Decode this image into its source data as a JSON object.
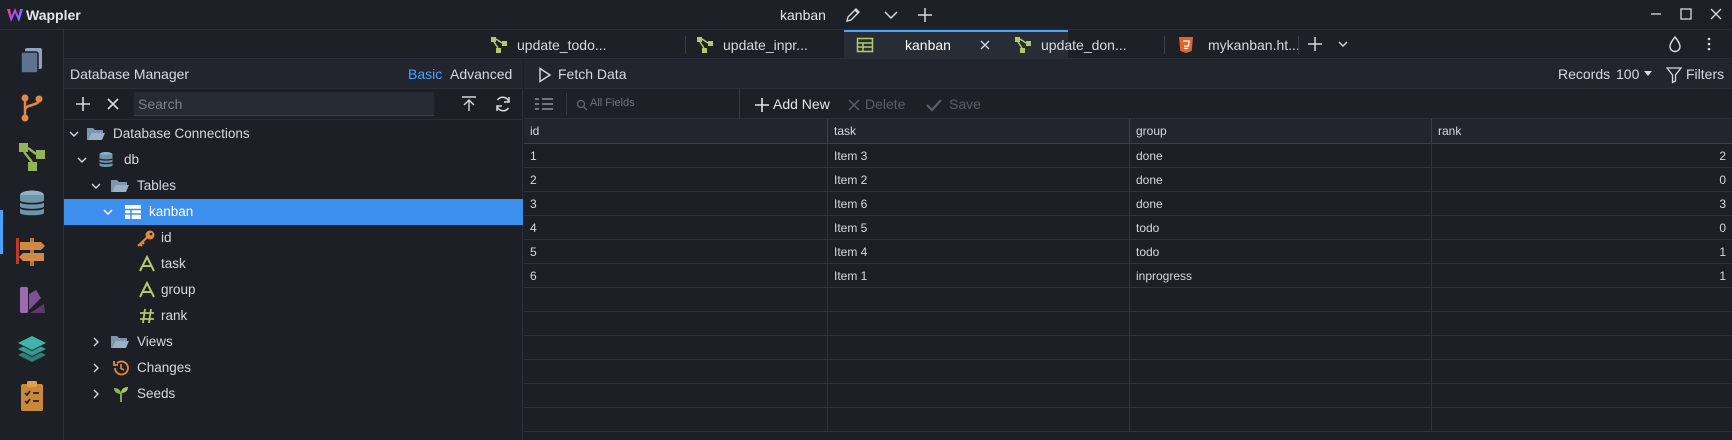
{
  "app": {
    "name": "Wappler",
    "document_title": "kanban"
  },
  "tabs": [
    {
      "label": "update_todo...",
      "icon": "server-action-icon",
      "active": false
    },
    {
      "label": "update_inpr...",
      "icon": "server-action-icon",
      "active": false
    },
    {
      "label": "kanban",
      "icon": "table-icon",
      "active": true
    },
    {
      "label": "update_don...",
      "icon": "server-action-icon",
      "active": false
    },
    {
      "label": "mykanban.ht...",
      "icon": "html5-icon",
      "active": false
    }
  ],
  "db_panel": {
    "title": "Database Manager",
    "mode_basic": "Basic",
    "mode_advanced": "Advanced",
    "search_placeholder": "Search",
    "tree": {
      "connections": "Database Connections",
      "db": "db",
      "tables": "Tables",
      "table": "kanban",
      "fields": [
        "id",
        "task",
        "group",
        "rank"
      ],
      "views": "Views",
      "changes": "Changes",
      "seeds": "Seeds"
    }
  },
  "data_toolbar": {
    "fetch": "Fetch Data",
    "records_label": "Records",
    "records_value": "100",
    "filters": "Filters"
  },
  "grid_toolbar": {
    "field_filter": "All Fields",
    "add_new": "Add New",
    "delete": "Delete",
    "save": "Save"
  },
  "grid": {
    "columns": [
      "id",
      "task",
      "group",
      "rank"
    ],
    "rows": [
      [
        "1",
        "Item 3",
        "done",
        "2"
      ],
      [
        "2",
        "Item 2",
        "done",
        "0"
      ],
      [
        "3",
        "Item 6",
        "done",
        "3"
      ],
      [
        "4",
        "Item 5",
        "todo",
        "0"
      ],
      [
        "5",
        "Item 4",
        "todo",
        "1"
      ],
      [
        "6",
        "Item 1",
        "inprogress",
        "1"
      ]
    ]
  },
  "colors": {
    "accent": "#4aa3ff",
    "selection": "#3d8fee",
    "background": "#1c1f26"
  }
}
